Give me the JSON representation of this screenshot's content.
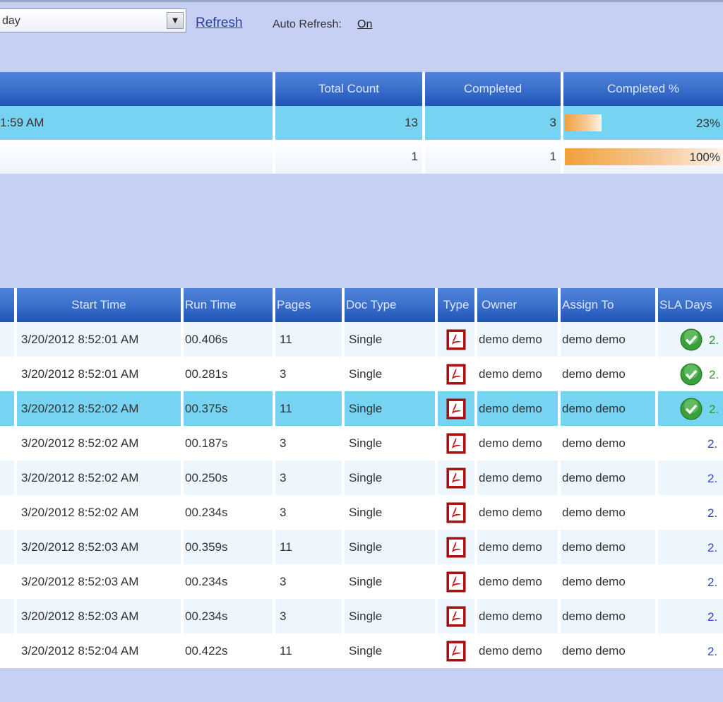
{
  "toolbar": {
    "period_value": "day",
    "refresh_label": "Refresh",
    "auto_refresh_label": "Auto Refresh:",
    "auto_refresh_value": "On"
  },
  "summary": {
    "columns": [
      "",
      "Total Count",
      "Completed",
      "Completed %"
    ],
    "rows": [
      {
        "name": "1:59 AM",
        "total": "13",
        "completed": "3",
        "pct": 0.23,
        "pct_label": "23%",
        "selected": true
      },
      {
        "name": "",
        "total": "1",
        "completed": "1",
        "pct": 1.0,
        "pct_label": "100%",
        "selected": false
      }
    ],
    "bar_color": "#f0a13c"
  },
  "detail": {
    "columns": [
      "",
      "Start Time",
      "Run Time",
      "Pages",
      "Doc Type",
      "Type",
      "Owner",
      "Assign To",
      "SLA Days"
    ],
    "rows": [
      {
        "start": "3/20/2012 8:52:01 AM",
        "run": "00.406s",
        "pages": "11",
        "doc": "Single",
        "owner": "demo demo",
        "assign": "demo demo",
        "sla": "2.",
        "sla_icon": true
      },
      {
        "start": "3/20/2012 8:52:01 AM",
        "run": "00.281s",
        "pages": "3",
        "doc": "Single",
        "owner": "demo demo",
        "assign": "demo demo",
        "sla": "2.",
        "sla_icon": true
      },
      {
        "start": "3/20/2012 8:52:02 AM",
        "run": "00.375s",
        "pages": "11",
        "doc": "Single",
        "owner": "demo demo",
        "assign": "demo demo",
        "sla": "2.",
        "sla_icon": true,
        "selected": true
      },
      {
        "start": "3/20/2012 8:52:02 AM",
        "run": "00.187s",
        "pages": "3",
        "doc": "Single",
        "owner": "demo demo",
        "assign": "demo demo",
        "sla": "2.",
        "sla_icon": false
      },
      {
        "start": "3/20/2012 8:52:02 AM",
        "run": "00.250s",
        "pages": "3",
        "doc": "Single",
        "owner": "demo demo",
        "assign": "demo demo",
        "sla": "2.",
        "sla_icon": false
      },
      {
        "start": "3/20/2012 8:52:02 AM",
        "run": "00.234s",
        "pages": "3",
        "doc": "Single",
        "owner": "demo demo",
        "assign": "demo demo",
        "sla": "2.",
        "sla_icon": false
      },
      {
        "start": "3/20/2012 8:52:03 AM",
        "run": "00.359s",
        "pages": "11",
        "doc": "Single",
        "owner": "demo demo",
        "assign": "demo demo",
        "sla": "2.",
        "sla_icon": false
      },
      {
        "start": "3/20/2012 8:52:03 AM",
        "run": "00.234s",
        "pages": "3",
        "doc": "Single",
        "owner": "demo demo",
        "assign": "demo demo",
        "sla": "2.",
        "sla_icon": false
      },
      {
        "start": "3/20/2012 8:52:03 AM",
        "run": "00.234s",
        "pages": "3",
        "doc": "Single",
        "owner": "demo demo",
        "assign": "demo demo",
        "sla": "2.",
        "sla_icon": false
      },
      {
        "start": "3/20/2012 8:52:04 AM",
        "run": "00.422s",
        "pages": "11",
        "doc": "Single",
        "owner": "demo demo",
        "assign": "demo demo",
        "sla": "2.",
        "sla_icon": false
      }
    ],
    "icons": {
      "type": "pdf-icon",
      "sla_ok": "check-circle-icon"
    },
    "colors": {
      "selected_row": "#76d3f1",
      "sla_ok": "#2f9c2f",
      "sla_pending": "#2f3fd4"
    }
  }
}
